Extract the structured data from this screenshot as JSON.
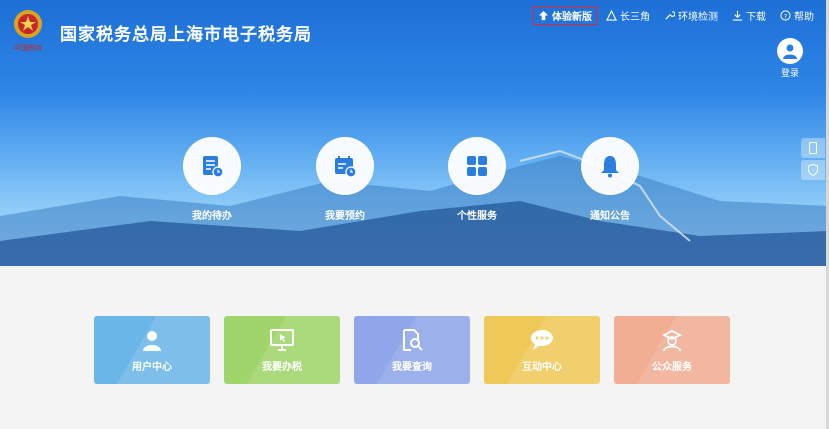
{
  "header": {
    "title": "国家税务总局上海市电子税务局",
    "logo_text": "中国税务"
  },
  "topbar": {
    "links": [
      {
        "label": "体验新版",
        "icon": "upload-arrow-icon",
        "highlighted": true
      },
      {
        "label": "长三角",
        "icon": "triangle-icon"
      },
      {
        "label": "环境检测",
        "icon": "wrench-icon"
      },
      {
        "label": "下载",
        "icon": "download-icon"
      },
      {
        "label": "帮助",
        "icon": "help-icon"
      }
    ]
  },
  "login": {
    "label": "登录"
  },
  "features": [
    {
      "label": "我的待办",
      "icon": "todo-list-icon"
    },
    {
      "label": "我要预约",
      "icon": "calendar-clock-icon"
    },
    {
      "label": "个性服务",
      "icon": "grid-icon"
    },
    {
      "label": "通知公告",
      "icon": "bell-icon"
    }
  ],
  "tiles": [
    {
      "label": "用户中心",
      "color": "#6bb6e8",
      "icon": "user-icon"
    },
    {
      "label": "我要办税",
      "color": "#9fd56a",
      "icon": "monitor-cursor-icon"
    },
    {
      "label": "我要查询",
      "color": "#8fa6ea",
      "icon": "search-doc-icon"
    },
    {
      "label": "互动中心",
      "color": "#efc958",
      "icon": "chat-icon"
    },
    {
      "label": "公众服务",
      "color": "#f1ae93",
      "icon": "service-person-icon"
    }
  ],
  "colors": {
    "accent": "#2a7ee0",
    "highlight_border": "#e5262b"
  }
}
